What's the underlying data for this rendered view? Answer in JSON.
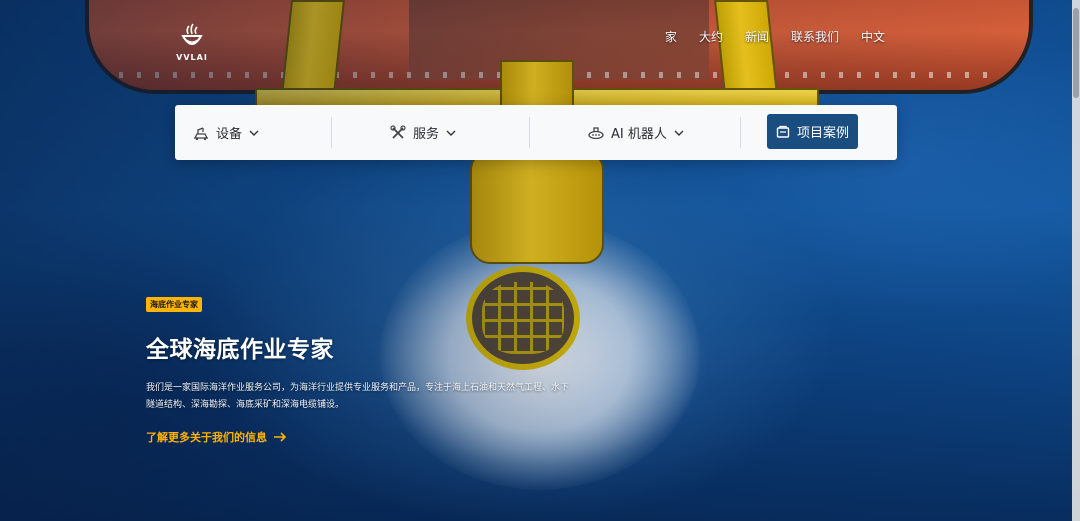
{
  "brand": {
    "logo_text": "VVLAI"
  },
  "topnav": {
    "items": [
      "家",
      "大约",
      "新闻",
      "联系我们",
      "中文"
    ]
  },
  "menu": {
    "equipment": {
      "label": "设备",
      "icon": "crane-icon"
    },
    "services": {
      "label": "服务",
      "icon": "tools-icon"
    },
    "robots": {
      "label": "AI 机器人",
      "icon": "submarine-icon"
    },
    "cases_button": {
      "label": "项目案例",
      "icon": "folder-icon"
    }
  },
  "hero": {
    "badge": "海底作业专家",
    "title": "全球海底作业专家",
    "description": "我们是一家国际海洋作业服务公司，为海洋行业提供专业服务和产品，专注于海上石油和天然气工程、水下隧道结构、深海勘探、海底采矿和深海电缆铺设。",
    "cta": "了解更多关于我们的信息"
  },
  "colors": {
    "accent": "#ffb400",
    "button": "#1a4d80",
    "menubar": "#f8f9fb"
  }
}
